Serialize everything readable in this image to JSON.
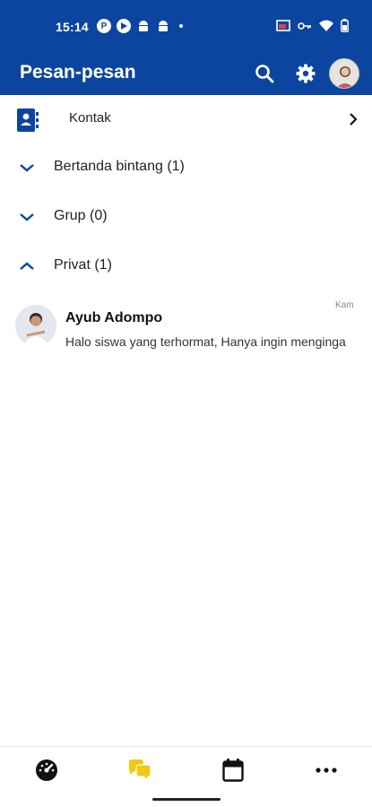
{
  "status_bar": {
    "time": "15:14",
    "left_icons": [
      "p-icon",
      "play-icon",
      "android-icon",
      "android-icon",
      "notification-dot"
    ],
    "right_icons": [
      "cast-icon",
      "key-icon",
      "wifi-icon",
      "battery-icon"
    ]
  },
  "app_bar": {
    "title": "Pesan-pesan",
    "actions": [
      "search-icon",
      "gear-icon",
      "avatar"
    ],
    "color": "#0c45a0"
  },
  "sections": {
    "contacts": {
      "label": "Kontak",
      "icon": "contacts-book-icon"
    },
    "starred": {
      "label": "Bertanda bintang (1)",
      "expanded": false
    },
    "groups": {
      "label": "Grup (0)",
      "expanded": false
    },
    "private": {
      "label": "Privat (1)",
      "expanded": true
    }
  },
  "messages": [
    {
      "sender": "Ayub Adompo",
      "preview": "Halo siswa yang terhormat, Hanya ingin menginga",
      "time": "Kam"
    }
  ],
  "bottom_nav": {
    "items": [
      "dashboard-icon",
      "messages-icon",
      "calendar-icon",
      "more-icon"
    ],
    "active_index": 1,
    "active_color": "#f2c811"
  }
}
